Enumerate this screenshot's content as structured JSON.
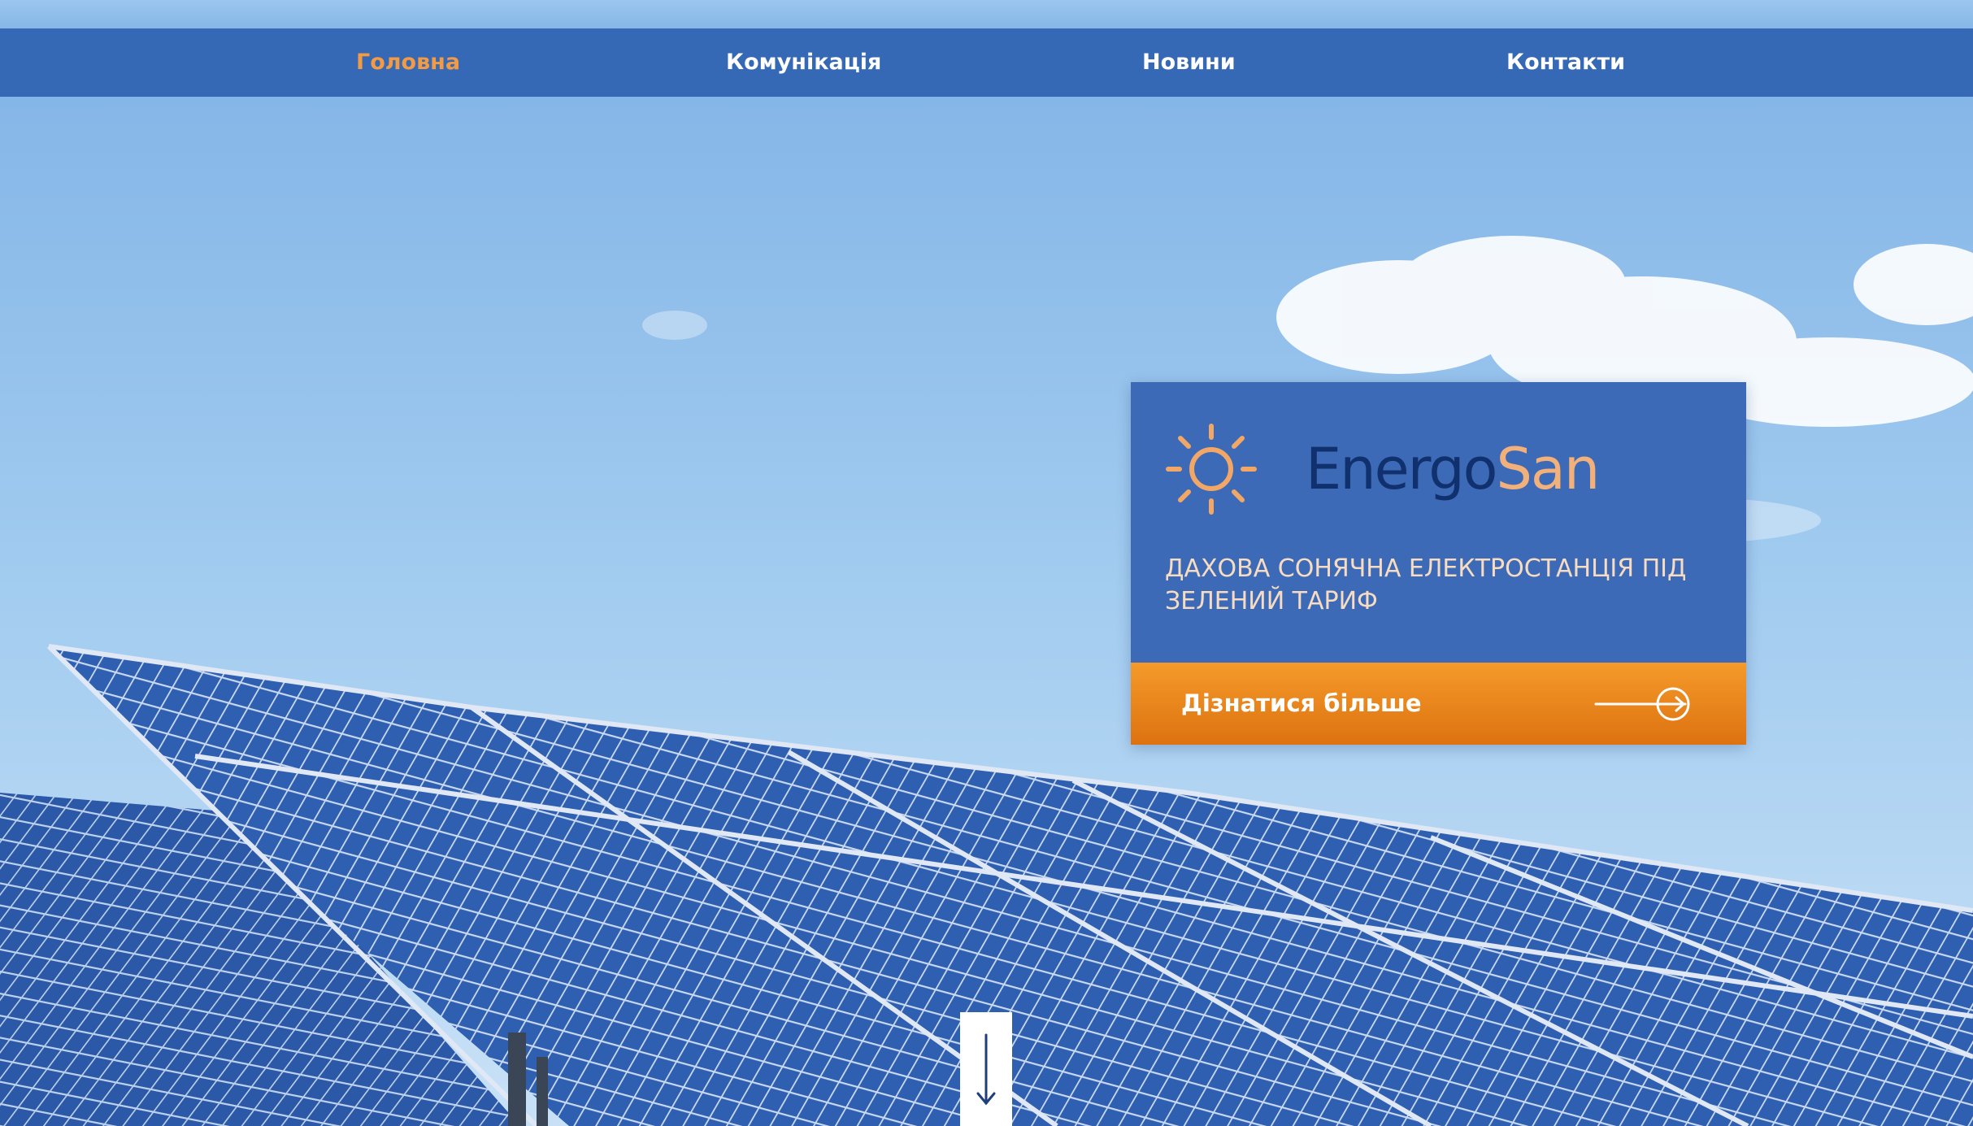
{
  "nav": {
    "items": [
      {
        "label": "Головна",
        "active": true
      },
      {
        "label": "Комунікація",
        "active": false
      },
      {
        "label": "Новини",
        "active": false
      },
      {
        "label": "Контакти",
        "active": false
      }
    ]
  },
  "hero": {
    "logo": {
      "part1": "Energo",
      "part2": "San"
    },
    "tagline": "ДАХОВА СОНЯЧНА ЕЛЕКТРОСТАНЦІЯ ПІД ЗЕЛЕНИЙ ТАРИФ",
    "cta_label": "Дізнатися більше",
    "icons": {
      "logo": "sun-icon",
      "cta": "arrow-right-circle-icon",
      "scroll": "arrow-down-icon"
    }
  },
  "colors": {
    "nav_bg": "#3568b5",
    "nav_active": "#f39a45",
    "card_bg": "#3c6ab7",
    "cta_orange": "#f08a1e",
    "logo_dark": "#10316e",
    "logo_light": "#f2b07a"
  }
}
